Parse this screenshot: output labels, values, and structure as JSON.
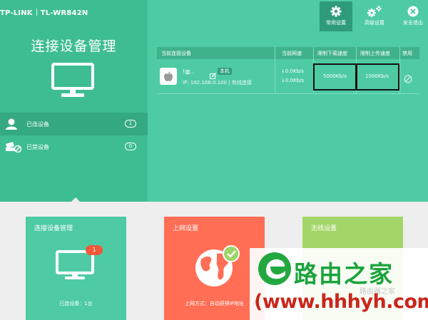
{
  "header": {
    "brand": "TP-LINK",
    "model": "TL-WR842N"
  },
  "left_panel": {
    "title": "连接设备管理",
    "nav": [
      {
        "label": "已连设备",
        "count": "1",
        "icon": "user-icon",
        "active": true
      },
      {
        "label": "已禁设备",
        "count": "0",
        "icon": "blocked-device-icon",
        "active": false
      }
    ]
  },
  "toolbar": [
    {
      "label": "常用设置",
      "icon": "gear-icon",
      "active": true
    },
    {
      "label": "高级设置",
      "icon": "gears-icon",
      "active": false
    },
    {
      "label": "安全退出",
      "icon": "close-circle-icon",
      "active": false
    }
  ],
  "device_table": {
    "columns": [
      "当前连接设备",
      "当前网速",
      "限制下载速度",
      "限制上传速度",
      "禁用"
    ],
    "rows": [
      {
        "icon": "apple-icon",
        "name": "!▥..",
        "tag": "本机",
        "ip_line": "IP: 192.168.0.100 | 有线连接",
        "down_rate": "↓0.0Kb/s",
        "up_rate": "↓0.0Kb/s",
        "down_limit": "5000Kb/s",
        "up_limit": "1000Kb/s"
      }
    ]
  },
  "cards": [
    {
      "title": "连接设备管理",
      "footer": "已连设备：1台",
      "badge": "1",
      "color": "#4ecba3"
    },
    {
      "title": "上网设置",
      "footer": "上网方式：自动获得IP地址",
      "color": "#ff6e55"
    },
    {
      "title": "无线设置",
      "color": "#a3d668"
    }
  ],
  "watermark": {
    "title": "路由之家",
    "url": "(www.hhhyh.com)",
    "faded": "路由器之家"
  }
}
